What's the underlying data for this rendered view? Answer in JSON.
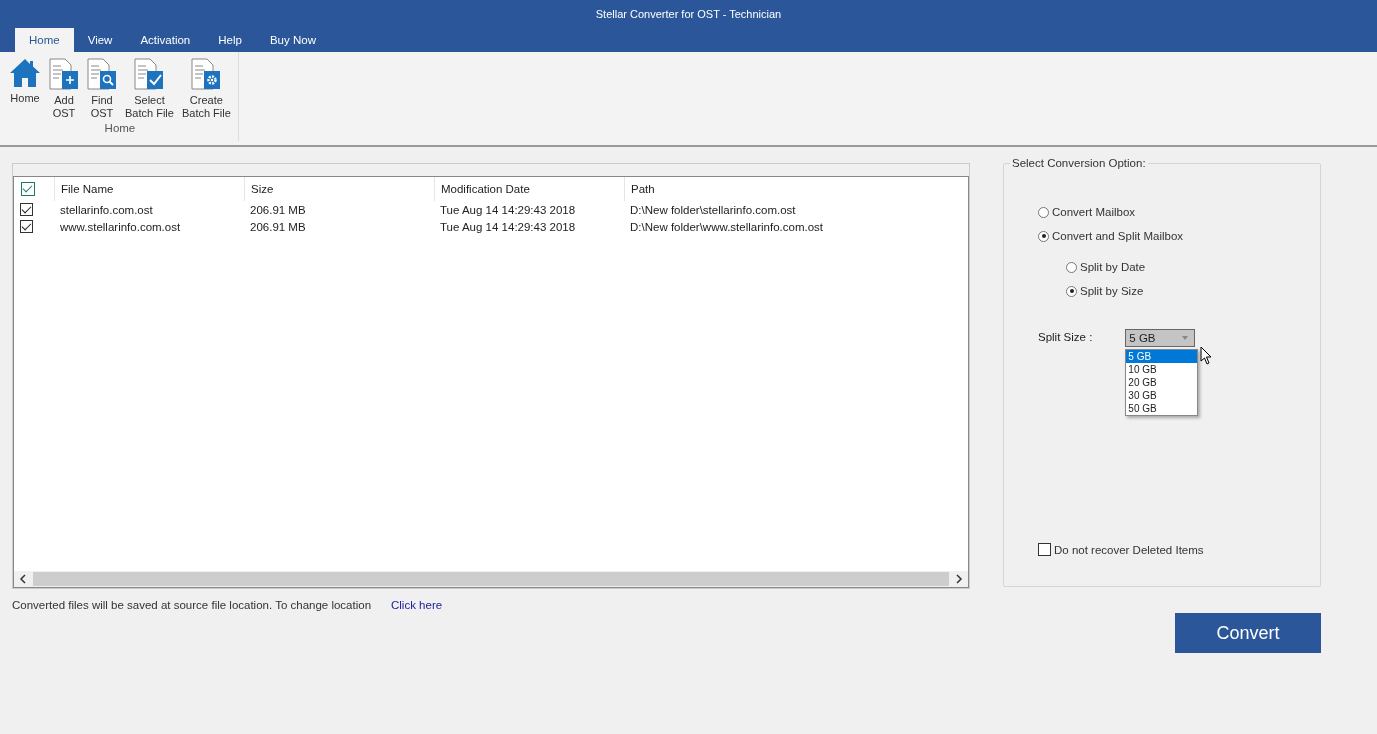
{
  "window": {
    "title": "Stellar Converter for OST - Technician"
  },
  "tabs": [
    {
      "label": "Home",
      "selected": true
    },
    {
      "label": "View",
      "selected": false
    },
    {
      "label": "Activation",
      "selected": false
    },
    {
      "label": "Help",
      "selected": false
    },
    {
      "label": "Buy Now",
      "selected": false
    }
  ],
  "ribbon": {
    "group_label": "Home",
    "buttons": [
      {
        "kind": "home",
        "label": "Home"
      },
      {
        "kind": "add",
        "label": "Add\nOST"
      },
      {
        "kind": "find",
        "label": "Find\nOST"
      },
      {
        "kind": "select",
        "label": "Select\nBatch File"
      },
      {
        "kind": "create",
        "label": "Create\nBatch File"
      }
    ]
  },
  "table": {
    "all_checked": true,
    "columns": [
      "File Name",
      "Size",
      "Modification Date",
      "Path"
    ],
    "rows": [
      {
        "checked": true,
        "cells": [
          "stellarinfo.com.ost",
          "206.91 MB",
          "Tue Aug 14 14:29:43 2018",
          "D:\\New folder\\stellarinfo.com.ost"
        ]
      },
      {
        "checked": true,
        "cells": [
          "www.stellarinfo.com.ost",
          "206.91 MB",
          "Tue Aug 14 14:29:43 2018",
          "D:\\New folder\\www.stellarinfo.com.ost"
        ]
      }
    ]
  },
  "save_note": {
    "text": "Converted files will be saved at source file location. To change location",
    "link": "Click here"
  },
  "conversion": {
    "title": "Select Conversion Option:",
    "options": [
      {
        "label": "Convert Mailbox",
        "selected": false
      },
      {
        "label": "Convert and Split Mailbox",
        "selected": true,
        "children": [
          {
            "label": "Split by Date",
            "selected": false
          },
          {
            "label": "Split by Size",
            "selected": true
          }
        ]
      }
    ],
    "split_size": {
      "label": "Split Size :",
      "value": "5 GB",
      "expanded": true,
      "options": [
        {
          "label": "5 GB",
          "selected": true
        },
        {
          "label": "10 GB",
          "selected": false
        },
        {
          "label": "20 GB",
          "selected": false
        },
        {
          "label": "30 GB",
          "selected": false
        },
        {
          "label": "50 GB",
          "selected": false
        }
      ]
    },
    "no_recover_deleted": {
      "label": "Do not recover Deleted Items",
      "checked": false
    }
  },
  "convert_button": "Convert"
}
